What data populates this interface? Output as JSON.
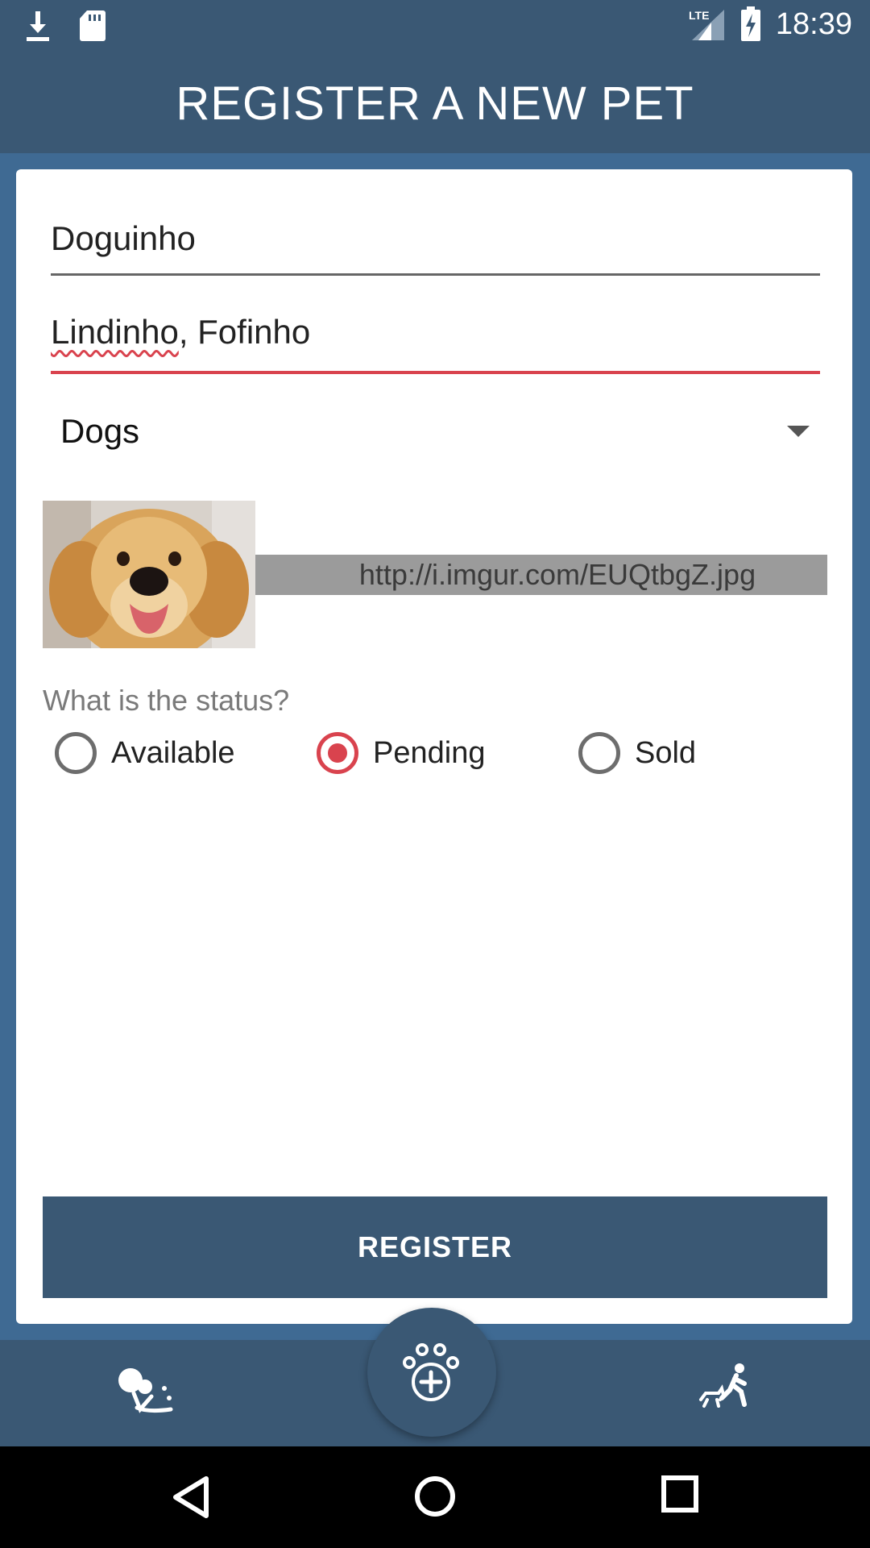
{
  "status_bar": {
    "time": "18:39",
    "network": "LTE",
    "icons": [
      "download-icon",
      "sd-card-icon",
      "signal-icon",
      "battery-charging-icon"
    ]
  },
  "app_bar": {
    "title": "REGISTER A NEW PET"
  },
  "form": {
    "name_value": "Doguinho",
    "tags_value_misspelled": "Lindinho",
    "tags_value_rest": ", Fofinho",
    "category": "Dogs",
    "image_url": "http://i.imgur.com/EUQtbgZ.jpg",
    "status_question": "What is the status?",
    "status_options": [
      {
        "label": "Available",
        "checked": false
      },
      {
        "label": "Pending",
        "checked": true
      },
      {
        "label": "Sold",
        "checked": false
      }
    ],
    "register_label": "REGISTER"
  },
  "bottom_nav": {
    "left_icon": "dog-lost-icon",
    "fab_icon": "paw-add-icon",
    "right_icon": "dog-walk-icon"
  },
  "colors": {
    "primary": "#3a5874",
    "background": "#3f6a93",
    "accent": "#d9434e",
    "url_box": "#9b9b9b"
  }
}
